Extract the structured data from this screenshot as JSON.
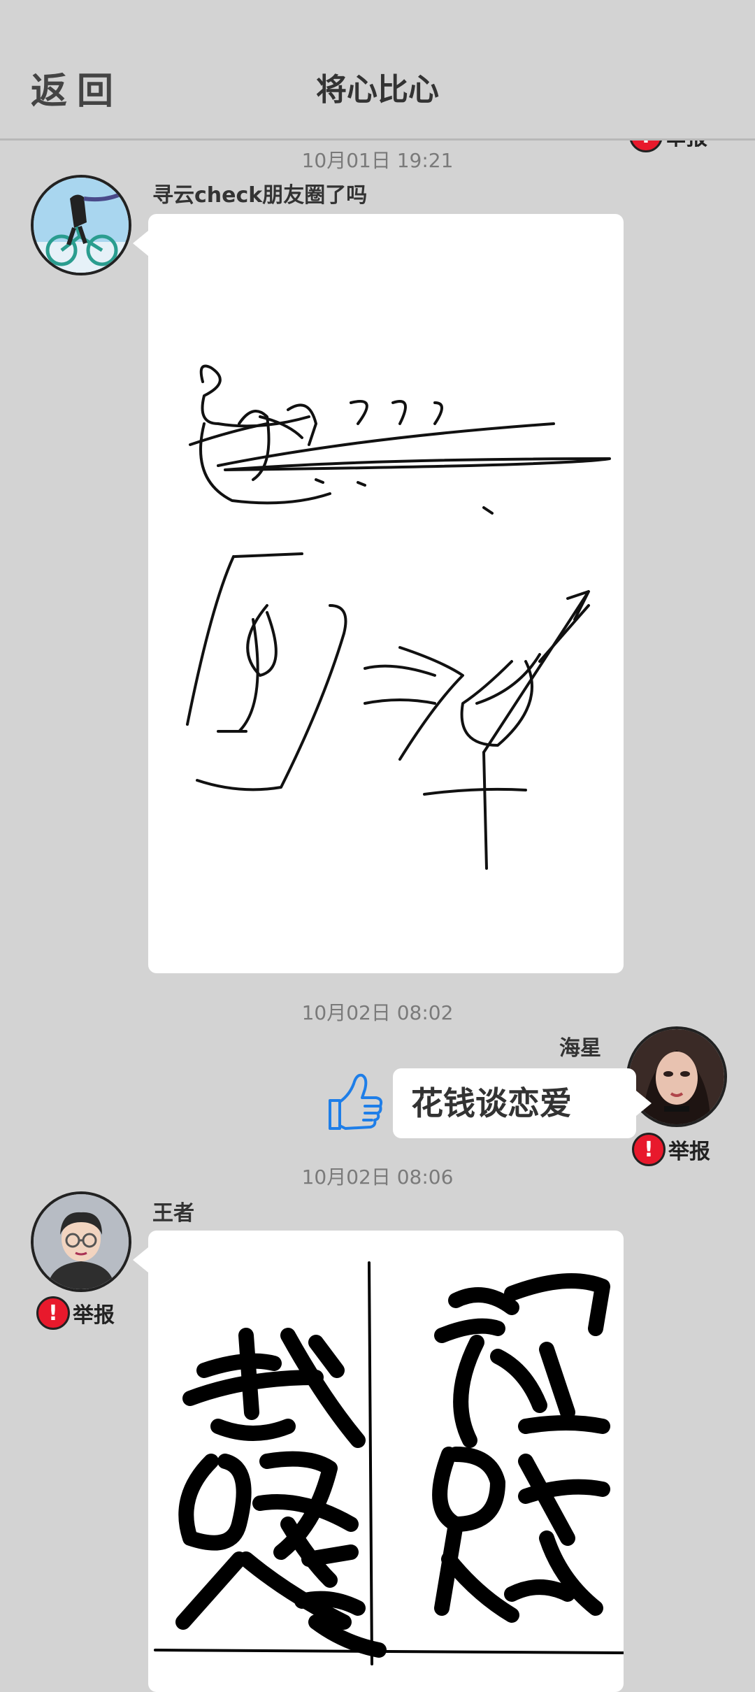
{
  "header": {
    "back_label": "返回",
    "title": "将心比心"
  },
  "messages": [
    {
      "time": "10月01日  19:21",
      "author": "寻云check朋友圈了吗",
      "side": "left",
      "type": "drawing"
    },
    {
      "time": "10月02日  08:02",
      "author": "海星",
      "side": "right",
      "type": "text",
      "text": "花钱谈恋爱"
    },
    {
      "time": "10月02日  08:06",
      "author": "王者",
      "side": "left",
      "type": "drawing"
    }
  ],
  "report_label": "举报",
  "colors": {
    "background": "#d3d3d3",
    "report_red": "#e8192c",
    "like_blue": "#1e7ee8"
  },
  "icons": {
    "report": "exclamation-circle-icon",
    "like": "thumbs-up-icon"
  }
}
